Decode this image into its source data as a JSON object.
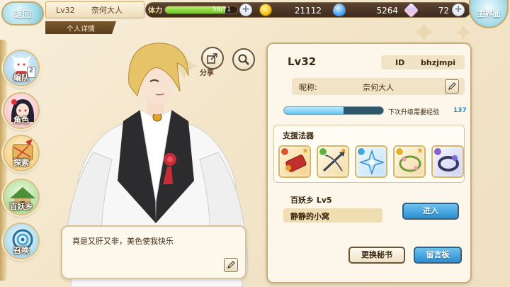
{
  "top_bar": {
    "back_label": "返回",
    "player_level": "Lv32",
    "player_name": "奈何大人",
    "detail_tab": "个人详情",
    "stamina_label": "体力",
    "stamina_text": "59/71",
    "stamina_fraction": 0.83,
    "gold": "21112",
    "drops": "5264",
    "gems": "72",
    "main_label": "主界面"
  },
  "nav": [
    {
      "label": "编队",
      "badge": "2"
    },
    {
      "label": "角色"
    },
    {
      "label": "探索"
    },
    {
      "label": "百妖乡"
    },
    {
      "label": "召唤"
    }
  ],
  "character": {
    "share_label": "分享",
    "quote": "真是又肝又非，美色使我快乐"
  },
  "panel": {
    "level": "Lv32",
    "id_key": "ID",
    "id_value": "bhzjmpi",
    "nick_key": "昵称:",
    "nick_value": "奈何大人",
    "exp_label": "下次升级需要经验",
    "exp_value": "137",
    "exp_fraction": 0.6,
    "support_title": "支援法器",
    "village_label": "百妖乡  Lv5",
    "village_name": "静静的小窝",
    "enter_button": "进入",
    "change_secretary_button": "更换秘书",
    "message_board_button": "留言板"
  },
  "colors": {
    "accent_blue": "#2a8fd2",
    "panel_bg": "#fcf7ea",
    "border_gold": "#c9ad78",
    "stamina_green": "#6ec22a"
  }
}
